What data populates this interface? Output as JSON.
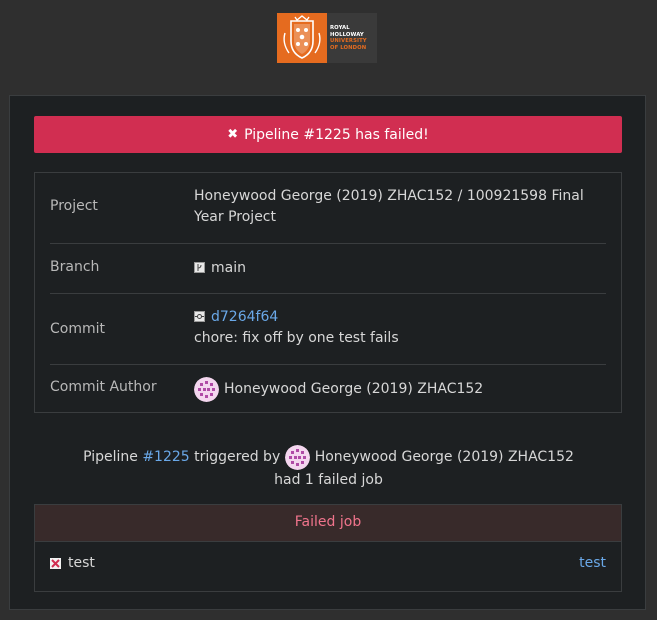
{
  "logo": {
    "line1": "ROYAL",
    "line2": "HOLLOWAY",
    "line3": "UNIVERSITY",
    "line4": "OF LONDON",
    "crest_color": "#e56b1f"
  },
  "banner": {
    "icon": "close-icon",
    "text": "Pipeline #1225 has failed!",
    "color": "#d12e51"
  },
  "details": {
    "project_label": "Project",
    "project_value": "Honeywood George (2019) ZHAC152 / 100921598 Final Year Project",
    "branch_label": "Branch",
    "branch_value": "main",
    "commit_label": "Commit",
    "commit_sha": "d7264f64",
    "commit_message": "chore: fix off by one test fails",
    "author_label": "Commit Author",
    "author_name": "Honeywood George (2019) ZHAC152"
  },
  "summary": {
    "prefix": "Pipeline",
    "pipeline_link": "#1225",
    "triggered_by": "triggered by",
    "user": "Honeywood George (2019) ZHAC152",
    "result": "had 1 failed job"
  },
  "failed_jobs": {
    "header": "Failed job",
    "jobs": [
      {
        "name": "test",
        "stage": "test",
        "status_icon": "failed-x-icon"
      }
    ]
  },
  "colors": {
    "link": "#6aa8e8",
    "failed_header_text": "#f0748c",
    "background": "#2f2f2f",
    "card": "#1d2022"
  }
}
